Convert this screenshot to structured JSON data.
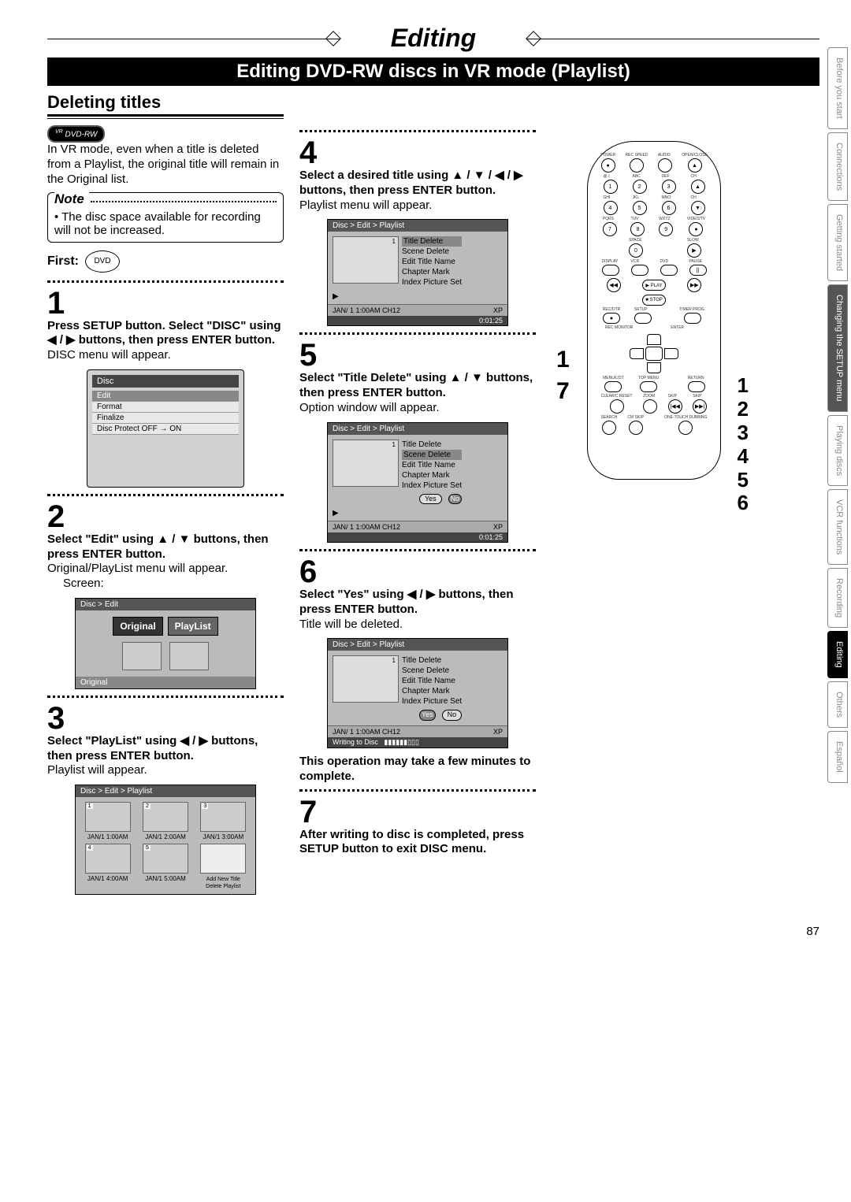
{
  "header": {
    "title": "Editing",
    "subtitle": "Editing DVD-RW discs in VR mode (Playlist)"
  },
  "section": {
    "heading": "Deleting titles",
    "badge_sup": "VR",
    "badge_label": "DVD-RW",
    "intro": "In VR mode, even when a title is deleted from a Playlist, the original title will remain in the Original list.",
    "note_label": "Note",
    "note_body": "• The disc space available for recording will not be increased.",
    "first_label": "First:",
    "first_icon": "DVD"
  },
  "steps": {
    "s1": {
      "num": "1",
      "text": "Press SETUP button. Select \"DISC\" using ◀ / ▶ buttons, then press ENTER button.",
      "sub": "DISC menu will appear."
    },
    "s2": {
      "num": "2",
      "text": "Select \"Edit\" using ▲ / ▼ buttons, then press ENTER button.",
      "sub": "Original/PlayList menu will appear.",
      "screen_label": "Screen:"
    },
    "s3": {
      "num": "3",
      "text": "Select \"PlayList\" using ◀ / ▶ buttons, then press ENTER button.",
      "sub": "Playlist will appear."
    },
    "s4": {
      "num": "4",
      "text": "Select a desired title using ▲ / ▼ / ◀ / ▶ buttons, then press ENTER button.",
      "sub": "Playlist menu will appear."
    },
    "s5": {
      "num": "5",
      "text": "Select \"Title Delete\" using ▲ / ▼ buttons, then press ENTER button.",
      "sub": "Option window will appear."
    },
    "s6": {
      "num": "6",
      "text": "Select \"Yes\" using ◀ / ▶ buttons, then press ENTER button.",
      "sub": "Title will be deleted.",
      "warn": "This operation may take a few minutes to complete."
    },
    "s7": {
      "num": "7",
      "text": "After writing to disc is completed, press SETUP button to exit DISC menu."
    }
  },
  "disc_menu": {
    "title": "Disc",
    "rows": [
      "Edit",
      "Format",
      "Finalize",
      "Disc Protect OFF → ON"
    ],
    "sel": 0
  },
  "edit_screen": {
    "breadcrumb": "Disc > Edit",
    "original": "Original",
    "playlist": "PlayList",
    "footer": "Original"
  },
  "playlist_screen": {
    "breadcrumb": "Disc > Edit > Playlist",
    "cells": [
      {
        "idx": "1",
        "lbl": "JAN/1  1:00AM"
      },
      {
        "idx": "2",
        "lbl": "JAN/1  2:00AM"
      },
      {
        "idx": "3",
        "lbl": "JAN/1  3:00AM"
      },
      {
        "idx": "4",
        "lbl": "JAN/1  4:00AM"
      },
      {
        "idx": "5",
        "lbl": "JAN/1  5:00AM"
      },
      {
        "idx": "",
        "lbl": "Add New Title\nDelete Playlist"
      }
    ]
  },
  "playlist_menu": {
    "breadcrumb": "Disc > Edit > Playlist",
    "items": [
      "Title Delete",
      "Scene Delete",
      "Edit Title Name",
      "Chapter Mark",
      "Index Picture Set"
    ],
    "footer_l": "JAN/ 1   1:00AM  CH12",
    "footer_m": "XP",
    "timer": "0:01:25",
    "yes": "Yes",
    "no": "No",
    "writing": "Writing to Disc"
  },
  "remote": {
    "row1": [
      "POWER",
      "REC SPEED",
      "AUDIO",
      "OPEN/CLOSE"
    ],
    "row2_lbl": [
      "@./:",
      "ABC",
      "DEF",
      ""
    ],
    "row2": [
      "1",
      "2",
      "3",
      "CH ▲"
    ],
    "row3_lbl": [
      "GHI",
      "JKL",
      "MNO",
      "CH"
    ],
    "row3": [
      "4",
      "5",
      "6",
      "▼"
    ],
    "row4_lbl": [
      "PQRS",
      "TUV",
      "WXYZ",
      "VIDEO/TV"
    ],
    "row4": [
      "7",
      "8",
      "9",
      "●"
    ],
    "row5_lbl": [
      "",
      "SPACE",
      "",
      "SLOW"
    ],
    "row5": [
      "",
      "0",
      "",
      "▶"
    ],
    "row6_lbl": [
      "DISPLAY",
      "VCR",
      "DVD",
      "PAUSE"
    ],
    "row6": [
      "⊙",
      "⊙",
      "⊙",
      "||"
    ],
    "play": "▶ PLAY",
    "rew": "◀◀",
    "ff": "▶▶",
    "stop": "■ STOP",
    "row7_lbl": [
      "REC/OTR",
      "SETUP",
      "",
      "TIMER PROG."
    ],
    "row8_lbl": [
      "REC MONITOR",
      "",
      "ENTER",
      ""
    ],
    "row9_lbl": [
      "MENU/LIST",
      "TOP MENU",
      "",
      "RETURN"
    ],
    "row10_lbl": [
      "CLEAR/C.RESET",
      "ZOOM",
      "SKIP",
      "SKIP"
    ],
    "row10": [
      "●",
      "●",
      "|◀◀",
      "▶▶|"
    ],
    "row11_lbl": [
      "SEARCH",
      "CM SKIP",
      "",
      "ONE-TOUCH DUBBING"
    ]
  },
  "callouts": {
    "left1": "1",
    "left7": "7",
    "right": "1\n2\n3\n4\n5\n6"
  },
  "tabs": [
    "Before you start",
    "Connections",
    "Getting started",
    "Changing the SETUP menu",
    "Playing discs",
    "VCR functions",
    "Recording",
    "Editing",
    "Others",
    "Español"
  ],
  "tabs_active": 7,
  "page_number": "87"
}
